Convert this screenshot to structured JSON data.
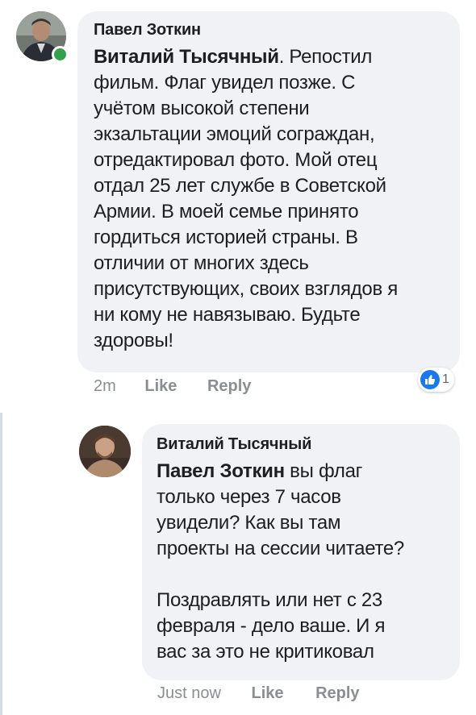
{
  "comment1": {
    "author": "Павел Зоткин",
    "mention": "Виталий Тысячный",
    "text_after_mention": ". Репостил",
    "lines": [
      "фильм. Флаг увидел позже. С",
      "учётом высокой степени",
      "экзальтации эмоций сограждан,",
      "отредактировал фото. Мой отец",
      "отдал 25 лет службе в Советской",
      "Армии. В моей семье принято",
      "гордиться историей страны. В",
      "отличии от многих здесь",
      "присутствующих, своих взглядов я",
      "ни кому не навязываю. Будьте",
      "здоровы!"
    ],
    "time": "2m",
    "like_label": "Like",
    "reply_label": "Reply",
    "reaction_count": "1",
    "reaction_icon": "like-thumb-icon",
    "online": true
  },
  "comment2": {
    "author": "Виталий Тысячный",
    "mention": "Павел Зоткин",
    "text_after_mention": " вы флаг",
    "lines": [
      "только через 7 часов",
      "увидели? Как вы там",
      "проекты на сессии читаете?",
      "",
      "Поздравлять или нет с 23",
      "февраля - дело ваше. И я",
      "вас за это не критиковал"
    ],
    "time": "Just now",
    "like_label": "Like",
    "reply_label": "Reply"
  },
  "colors": {
    "bubble": "#f0f2f5",
    "muted": "#8a8d91",
    "text": "#1c1e21",
    "like_blue": "#1877f2",
    "online_green": "#31a24c"
  }
}
